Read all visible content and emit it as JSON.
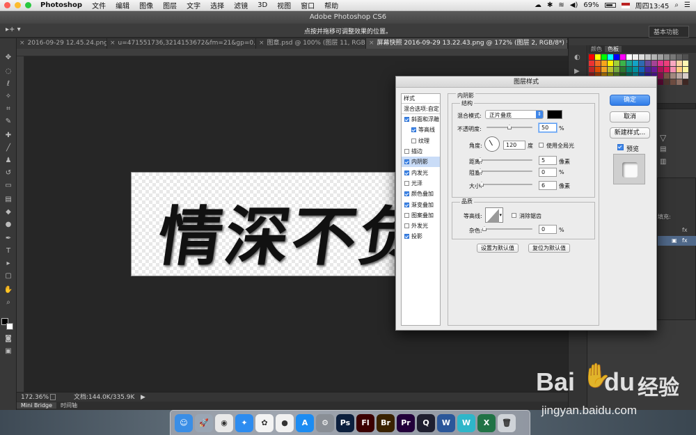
{
  "menubar": {
    "app": "Photoshop",
    "items": [
      "文件",
      "编辑",
      "图像",
      "图层",
      "文字",
      "选择",
      "滤镜",
      "3D",
      "视图",
      "窗口",
      "帮助"
    ],
    "battery": "69%",
    "clock": "周四13:45"
  },
  "window": {
    "title": "Adobe Photoshop CS6"
  },
  "options": {
    "hint": "点按并拖移可调整效果的位置。",
    "workspace": "基本功能"
  },
  "tabs": [
    {
      "label": "2016-09-29 12.45.24.png"
    },
    {
      "label": "u=471551736,3214153672&fm=21&gp=0.jpg"
    },
    {
      "label": "图章.psd @ 100% (图层 11, RGB/..."
    },
    {
      "label": "屏幕快照 2016-09-29 13.22.43.png @ 172% (图层 2, RGB/8*) *"
    }
  ],
  "canvas": {
    "artwork_text": "情深不负"
  },
  "status": {
    "zoom": "172.36%",
    "doc": "文档:144.0K/335.9K",
    "tabs": [
      "Mini Bridge",
      "时间轴"
    ]
  },
  "panels": {
    "tabs": [
      "颜色",
      "色板"
    ],
    "fill_label": "填充:"
  },
  "dialog": {
    "title": "图层样式",
    "list_header": "样式",
    "blend_options": "混合选项:自定",
    "styles": [
      {
        "label": "斜面和浮雕",
        "checked": true,
        "sub": false,
        "selected": false
      },
      {
        "label": "等高线",
        "checked": true,
        "sub": true,
        "selected": false
      },
      {
        "label": "纹理",
        "checked": false,
        "sub": true,
        "selected": false
      },
      {
        "label": "描边",
        "checked": false,
        "sub": false,
        "selected": false
      },
      {
        "label": "内阴影",
        "checked": true,
        "sub": false,
        "selected": true
      },
      {
        "label": "内发光",
        "checked": true,
        "sub": false,
        "selected": false
      },
      {
        "label": "光泽",
        "checked": false,
        "sub": false,
        "selected": false
      },
      {
        "label": "颜色叠加",
        "checked": true,
        "sub": false,
        "selected": false
      },
      {
        "label": "渐变叠加",
        "checked": true,
        "sub": false,
        "selected": false
      },
      {
        "label": "图案叠加",
        "checked": false,
        "sub": false,
        "selected": false
      },
      {
        "label": "外发光",
        "checked": false,
        "sub": false,
        "selected": false
      },
      {
        "label": "投影",
        "checked": true,
        "sub": false,
        "selected": false
      }
    ],
    "section": "内阴影",
    "structure": "结构",
    "blend_mode_label": "混合模式:",
    "blend_mode": "正片叠底",
    "opacity_label": "不透明度:",
    "opacity": "50",
    "opacity_level": 50,
    "percent": "%",
    "angle_label": "角度:",
    "angle": "120",
    "degree": "度",
    "global_light": "使用全局光",
    "distance_label": "距离:",
    "distance": "5",
    "choke_label": "阻塞:",
    "choke": "0",
    "size_label": "大小:",
    "size": "6",
    "pixels": "像素",
    "quality": "品质",
    "contour_label": "等高线:",
    "antialias": "消除锯齿",
    "noise_label": "杂色:",
    "noise": "0",
    "set_default": "设置为默认值",
    "reset_default": "复位为默认值",
    "ok": "确定",
    "cancel": "取消",
    "new_style": "新建样式...",
    "preview": "预览",
    "colors": {
      "shadow": "#000000",
      "accent": "#3f86e8"
    }
  },
  "dock": {
    "apps": [
      {
        "icon": "finder-icon",
        "color": "#3a8ee6",
        "glyph": "☺"
      },
      {
        "icon": "launchpad-icon",
        "color": "#9aa6b4",
        "glyph": "🚀"
      },
      {
        "icon": "chrome-icon",
        "color": "#e9e9e9",
        "glyph": "◉"
      },
      {
        "icon": "safari-icon",
        "color": "#2d8cf0",
        "glyph": "✦"
      },
      {
        "icon": "photos-icon",
        "color": "#f3f3f3",
        "glyph": "✿"
      },
      {
        "icon": "qq-icon",
        "color": "#f1f1f1",
        "glyph": "●"
      },
      {
        "icon": "appstore-icon",
        "color": "#1c8cf2",
        "glyph": "A"
      },
      {
        "icon": "system-prefs-icon",
        "color": "#8a8f96",
        "glyph": "⚙"
      },
      {
        "icon": "ps-icon",
        "color": "#0c1f3d",
        "glyph": "Ps"
      },
      {
        "icon": "flash-icon",
        "color": "#3b0000",
        "glyph": "Fl"
      },
      {
        "icon": "bridge-icon",
        "color": "#3a2200",
        "glyph": "Br"
      },
      {
        "icon": "premiere-icon",
        "color": "#22003a",
        "glyph": "Pr"
      },
      {
        "icon": "quicktime-icon",
        "color": "#1f1f30",
        "glyph": "Q"
      },
      {
        "icon": "word-icon",
        "color": "#2b579a",
        "glyph": "W"
      },
      {
        "icon": "wunderlist-icon",
        "color": "#2fb6c9",
        "glyph": "W"
      },
      {
        "icon": "excel-icon",
        "color": "#217346",
        "glyph": "X"
      },
      {
        "icon": "trash-icon",
        "color": "#cfd3d8",
        "glyph": "🗑"
      }
    ]
  },
  "watermark": {
    "brand_a": "Bai",
    "brand_b": "du",
    "brand_c": "经验",
    "url": "jingyan.baidu.com"
  }
}
